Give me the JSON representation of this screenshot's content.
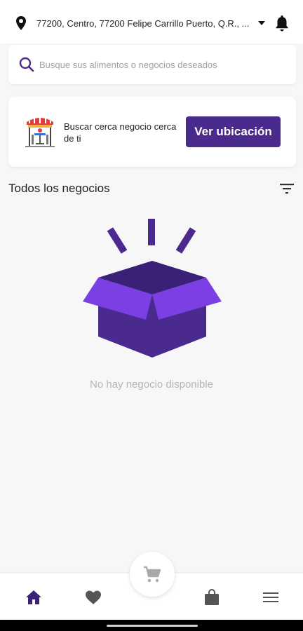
{
  "header": {
    "location": "77200, Centro, 77200 Felipe Carrillo Puerto, Q.R., ...",
    "location_icon": "location-pin-icon",
    "dropdown_icon": "caret-down-icon",
    "notification_icon": "bell-icon"
  },
  "search": {
    "placeholder": "Busque sus alimentos o negocios deseados",
    "icon": "search-icon"
  },
  "banner": {
    "text": "Buscar cerca negocio cerca de ti",
    "button_label": "Ver ubicación",
    "illustration": "storefront-icon"
  },
  "section": {
    "title": "Todos los negocios",
    "filter_icon": "filter-icon"
  },
  "empty_state": {
    "icon": "open-box-icon",
    "message": "No hay negocio disponible"
  },
  "bottom_nav": {
    "items": [
      {
        "name": "home",
        "icon": "home-icon",
        "active": true
      },
      {
        "name": "favorites",
        "icon": "heart-icon",
        "active": false
      },
      {
        "name": "cart",
        "icon": "cart-icon",
        "active": false
      },
      {
        "name": "orders",
        "icon": "bag-icon",
        "active": false
      },
      {
        "name": "menu",
        "icon": "menu-icon",
        "active": false
      }
    ]
  },
  "colors": {
    "primary": "#4a2a8c",
    "box_light": "#7b3fe4",
    "box_dark": "#4b2a8f",
    "muted": "#b5b5b5",
    "background": "#f7f7f7"
  }
}
